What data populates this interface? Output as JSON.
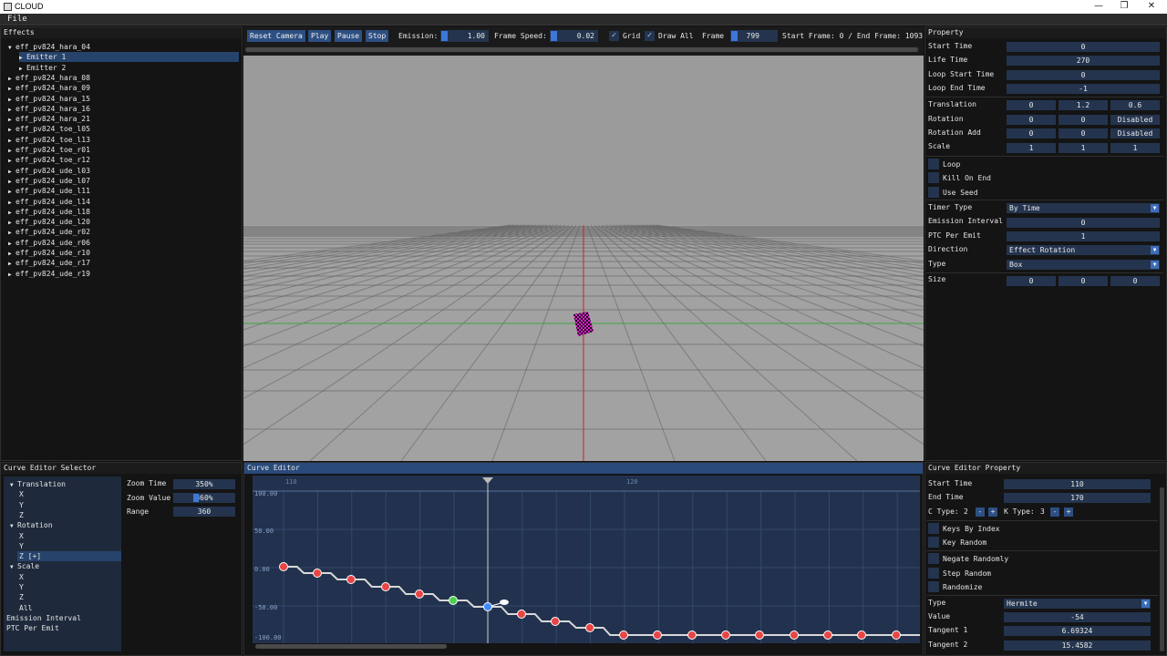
{
  "app": {
    "title": "CLOUD",
    "menu": [
      "File"
    ]
  },
  "effects_panel": {
    "title": "Effects",
    "items": [
      {
        "label": "eff_pv824_hara_04",
        "expanded": true
      },
      {
        "label": "Emitter 1",
        "child": true,
        "selected": true
      },
      {
        "label": "Emitter 2",
        "child": true
      },
      {
        "label": "eff_pv824_hara_08"
      },
      {
        "label": "eff_pv824_hara_09"
      },
      {
        "label": "eff_pv824_hara_15"
      },
      {
        "label": "eff_pv824_hara_16"
      },
      {
        "label": "eff_pv824_hara_21"
      },
      {
        "label": "eff_pv824_toe_l05"
      },
      {
        "label": "eff_pv824_toe_l13"
      },
      {
        "label": "eff_pv824_toe_r01"
      },
      {
        "label": "eff_pv824_toe_r12"
      },
      {
        "label": "eff_pv824_ude_l03"
      },
      {
        "label": "eff_pv824_ude_l07"
      },
      {
        "label": "eff_pv824_ude_l11"
      },
      {
        "label": "eff_pv824_ude_l14"
      },
      {
        "label": "eff_pv824_ude_l18"
      },
      {
        "label": "eff_pv824_ude_l20"
      },
      {
        "label": "eff_pv824_ude_r02"
      },
      {
        "label": "eff_pv824_ude_r06"
      },
      {
        "label": "eff_pv824_ude_r10"
      },
      {
        "label": "eff_pv824_ude_r17"
      },
      {
        "label": "eff_pv824_ude_r19"
      }
    ]
  },
  "toolbar": {
    "reset_camera": "Reset Camera",
    "play": "Play",
    "pause": "Pause",
    "stop": "Stop",
    "emission_label": "Emission:",
    "emission_value": "1.00",
    "frame_speed_label": "Frame Speed:",
    "frame_speed_value": "0.02",
    "grid_label": "Grid",
    "grid_checked": true,
    "draw_all_label": "Draw All",
    "draw_all_checked": true,
    "frame_label": "Frame",
    "frame_value": "799",
    "frame_range": "Start Frame: 0 / End Frame: 10936"
  },
  "property": {
    "title": "Property",
    "start_time": {
      "label": "Start Time",
      "value": "0"
    },
    "life_time": {
      "label": "Life Time",
      "value": "270"
    },
    "loop_start_time": {
      "label": "Loop Start Time",
      "value": "0"
    },
    "loop_end_time": {
      "label": "Loop End Time",
      "value": "-1"
    },
    "translation": {
      "label": "Translation",
      "values": [
        "0",
        "1.2",
        "0.6"
      ]
    },
    "rotation": {
      "label": "Rotation",
      "values": [
        "0",
        "0",
        "Disabled"
      ]
    },
    "rotation_add": {
      "label": "Rotation Add",
      "values": [
        "0",
        "0",
        "Disabled"
      ]
    },
    "scale": {
      "label": "Scale",
      "values": [
        "1",
        "1",
        "1"
      ]
    },
    "loop": "Loop",
    "kill_on_end": "Kill On End",
    "use_seed": "Use Seed",
    "timer_type": {
      "label": "Timer Type",
      "value": "By Time"
    },
    "emission_interval": {
      "label": "Emission Interval",
      "value": "0"
    },
    "ptc_per_emit": {
      "label": "PTC Per Emit",
      "value": "1"
    },
    "direction": {
      "label": "Direction",
      "value": "Effect Rotation"
    },
    "type": {
      "label": "Type",
      "value": "Box"
    },
    "size": {
      "label": "Size",
      "values": [
        "0",
        "0",
        "0"
      ]
    }
  },
  "curve_selector": {
    "title": "Curve Editor Selector",
    "tree": [
      {
        "label": "Translation",
        "group": true
      },
      {
        "label": "X"
      },
      {
        "label": "Y"
      },
      {
        "label": "Z"
      },
      {
        "label": "Rotation",
        "group": true
      },
      {
        "label": "X"
      },
      {
        "label": "Y"
      },
      {
        "label": "Z [+]",
        "selected": true
      },
      {
        "label": "Scale",
        "group": true
      },
      {
        "label": "X"
      },
      {
        "label": "Y"
      },
      {
        "label": "Z"
      },
      {
        "label": "All"
      },
      {
        "label": "Emission Interval",
        "top": true
      },
      {
        "label": "PTC Per Emit",
        "top": true
      }
    ],
    "zoom_time": {
      "label": "Zoom Time",
      "value": "350%"
    },
    "zoom_value": {
      "label": "Zoom Value",
      "value": "360%"
    },
    "range": {
      "label": "Range",
      "value": "360"
    }
  },
  "curve_editor": {
    "title": "Curve Editor",
    "frame_marks": [
      "110",
      "120"
    ],
    "value_marks": [
      "100.00",
      "50.00",
      "0.00",
      "-50.00",
      "-100.00"
    ]
  },
  "curve_property": {
    "title": "Curve Editor Property",
    "start_time": {
      "label": "Start Time",
      "value": "110"
    },
    "end_time": {
      "label": "End Time",
      "value": "170"
    },
    "c_type": {
      "label": "C Type:",
      "value": "2"
    },
    "k_type": {
      "label": "K Type:",
      "value": "3"
    },
    "minus": "-",
    "plus": "+",
    "keys_by_index": "Keys By Index",
    "key_random": "Key Random",
    "negate_randomly": "Negate Randomly",
    "step_random": "Step Random",
    "randomize": "Randomize",
    "type": {
      "label": "Type",
      "value": "Hermite"
    },
    "value": {
      "label": "Value",
      "value": "-54"
    },
    "tangent1": {
      "label": "Tangent 1",
      "value": "6.69324"
    },
    "tangent2": {
      "label": "Tangent 2",
      "value": "15.4582"
    }
  },
  "colors": {
    "accent": "#2d4f82",
    "key_red": "#e84545",
    "key_green": "#4bd14b",
    "key_blue": "#3d8bff"
  }
}
